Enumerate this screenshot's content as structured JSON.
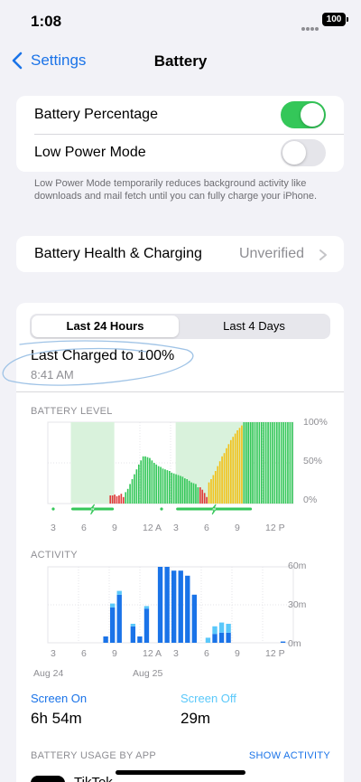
{
  "status": {
    "time": "1:08",
    "battery_level": "100"
  },
  "nav": {
    "back_label": "Settings",
    "title": "Battery"
  },
  "toggles": [
    {
      "label": "Battery Percentage",
      "on": true
    },
    {
      "label": "Low Power Mode",
      "on": false
    }
  ],
  "low_power_footnote": "Low Power Mode temporarily reduces background activity like downloads and mail fetch until you can fully charge your iPhone.",
  "health": {
    "label": "Battery Health & Charging",
    "value": "Unverified"
  },
  "range_tabs": {
    "selected": "Last 24 Hours",
    "other": "Last 4 Days"
  },
  "last_charged": {
    "title": "Last Charged to 100%",
    "time": "8:41 AM"
  },
  "colors": {
    "accent": "#1a73e8",
    "toggle_on": "#34c759",
    "battery_normal": "#34c759",
    "battery_low": "#e03a3a",
    "battery_low_power": "#f2c21a",
    "charging_fill": "#d9f2dc",
    "screen_on": "#1a73e8",
    "screen_off": "#5ac8fa"
  },
  "chart_data": [
    {
      "type": "bar",
      "title": "BATTERY LEVEL",
      "x_tick_labels": [
        "3",
        "6",
        "9",
        "12 A",
        "3",
        "6",
        "9",
        "12 P"
      ],
      "y_tick_labels": [
        "100%",
        "50%",
        "0%"
      ],
      "ylim": [
        0,
        100
      ],
      "values": [
        0,
        0,
        0,
        0,
        0,
        0,
        0,
        0,
        0,
        0,
        0,
        0,
        0,
        0,
        0,
        0,
        0,
        0,
        0,
        0,
        0,
        0,
        0,
        0,
        0,
        0,
        0,
        0,
        10,
        10,
        11,
        9,
        10,
        12,
        8,
        14,
        18,
        24,
        30,
        36,
        42,
        48,
        53,
        58,
        58,
        57,
        56,
        53,
        50,
        48,
        46,
        45,
        43,
        42,
        41,
        40,
        38,
        37,
        36,
        35,
        34,
        33,
        31,
        30,
        28,
        26,
        25,
        24,
        20,
        20,
        17,
        13,
        8,
        26,
        30,
        35,
        40,
        46,
        52,
        58,
        62,
        68,
        73,
        78,
        82,
        86,
        90,
        93,
        96,
        100,
        100,
        100,
        100,
        100,
        100,
        100,
        100,
        100,
        100,
        100,
        100,
        100,
        100,
        100,
        100,
        100,
        100,
        100,
        100,
        100,
        100,
        100
      ],
      "bar_status": "low: 28-34, normal: 35-68, low: 69-72, low_power: 73-88, normal: 89-111",
      "charging_periods": [
        [
          18,
          52
        ],
        [
          100,
          160
        ]
      ]
    },
    {
      "type": "bar",
      "title": "ACTIVITY",
      "x_tick_labels": [
        "3",
        "6",
        "9",
        "12 A",
        "3",
        "6",
        "9",
        "12 P"
      ],
      "date_labels": [
        "Aug 24",
        "Aug 25"
      ],
      "y_tick_labels": [
        "60m",
        "30m",
        "0m"
      ],
      "ylim": [
        0,
        60
      ],
      "series": [
        {
          "name": "Screen On",
          "values": [
            0,
            0,
            0,
            0,
            0,
            0,
            0,
            0,
            5,
            28,
            38,
            0,
            13,
            5,
            27,
            0,
            60,
            60,
            57,
            57,
            53,
            38,
            0,
            0,
            7,
            8,
            8,
            0,
            0,
            0,
            0,
            0,
            0,
            0,
            1,
            0
          ]
        },
        {
          "name": "Screen Off",
          "values": [
            0,
            0,
            0,
            0,
            0,
            0,
            0,
            0,
            0,
            3,
            3,
            0,
            2,
            0,
            2,
            0,
            0,
            0,
            0,
            0,
            0,
            0,
            0,
            4,
            6,
            8,
            7,
            0,
            0,
            0,
            0,
            0,
            0,
            0,
            0,
            0
          ]
        }
      ]
    }
  ],
  "usage": {
    "screen_on_label": "Screen On",
    "screen_on_value": "6h 54m",
    "screen_off_label": "Screen Off",
    "screen_off_value": "29m"
  },
  "footer": {
    "section_title": "BATTERY USAGE BY APP",
    "action": "SHOW ACTIVITY",
    "first_app": "TikTok"
  }
}
